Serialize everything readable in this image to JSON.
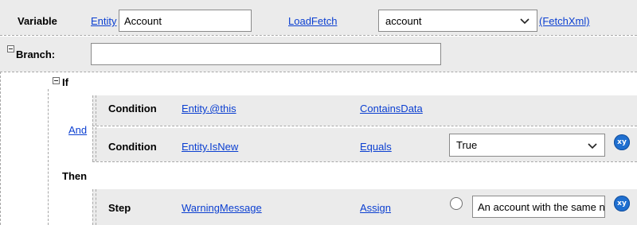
{
  "variable_row": {
    "label": "Variable",
    "entity_link": "Entity",
    "entity_value": "Account",
    "operator_link": "LoadFetch",
    "fetch_select": "account",
    "fetchxml_link": "(FetchXml)"
  },
  "branch": {
    "label": "Branch:",
    "value": ""
  },
  "if_block": {
    "label": "If",
    "connector": "And",
    "conditions": [
      {
        "label": "Condition",
        "field": "Entity.@this",
        "operator": "ContainsData"
      },
      {
        "label": "Condition",
        "field": "Entity.IsNew",
        "operator": "Equals",
        "value": "True",
        "xy_label": "xy"
      }
    ]
  },
  "then_block": {
    "label": "Then",
    "step": {
      "label": "Step",
      "target": "WarningMessage",
      "operator": "Assign",
      "value": "An account with the same n",
      "xy_label": "xy"
    }
  }
}
